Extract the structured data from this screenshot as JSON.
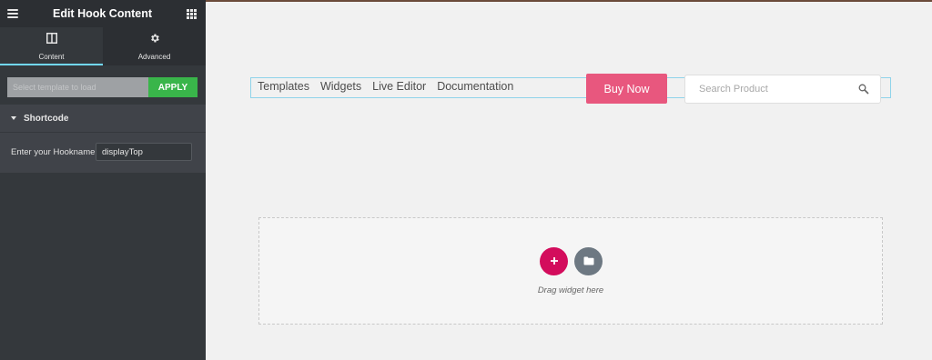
{
  "panel": {
    "title": "Edit Hook Content",
    "tabs": [
      {
        "label": "Content",
        "icon": "layout-icon",
        "active": true
      },
      {
        "label": "Advanced",
        "icon": "gear-icon",
        "active": false
      }
    ],
    "template": {
      "placeholder": "Select template to load",
      "apply_label": "APPLY"
    },
    "section": {
      "title": "Shortcode",
      "field_label": "Enter your Hookname",
      "field_value": "displayTop"
    }
  },
  "canvas": {
    "nav_links": [
      "Templates",
      "Widgets",
      "Live Editor",
      "Documentation"
    ],
    "buy_label": "Buy Now",
    "search_placeholder": "Search Product",
    "drop_text": "Drag widget here"
  },
  "colors": {
    "panel_bg": "#34383c",
    "tab_accent": "#71d7f7",
    "apply_green": "#39b54a",
    "buy_pink": "#e8577e",
    "add_crimson": "#d30c5c",
    "folder_gray": "#6d7882"
  }
}
